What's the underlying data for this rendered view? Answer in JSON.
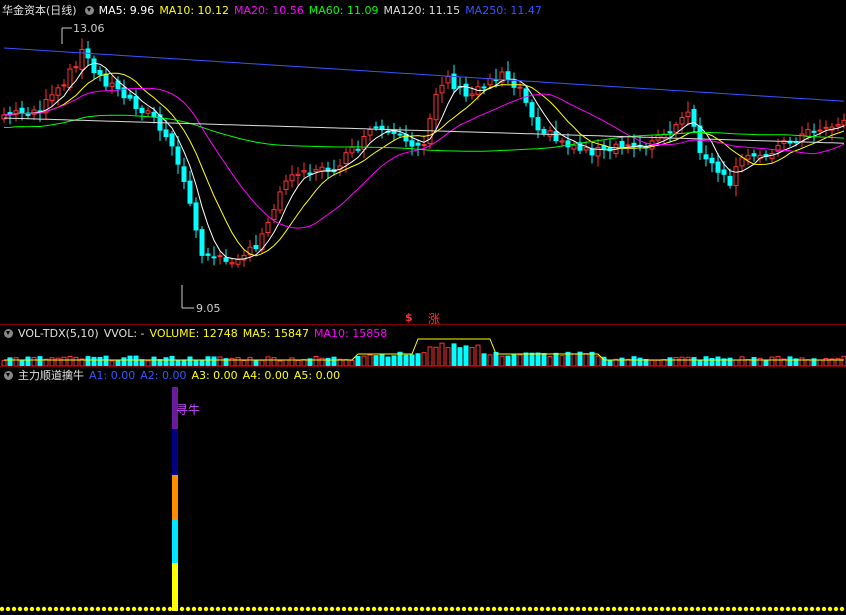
{
  "main_panel": {
    "title": "华金资本(日线)",
    "ma": [
      {
        "label": "MA5: 9.96",
        "color": "#ffffff"
      },
      {
        "label": "MA10: 10.12",
        "color": "#ffff00"
      },
      {
        "label": "MA20: 10.56",
        "color": "#ff00ff"
      },
      {
        "label": "MA60: 11.09",
        "color": "#00ff00"
      },
      {
        "label": "MA120: 11.15",
        "color": "#dddddd"
      },
      {
        "label": "MA250: 11.47",
        "color": "#3355ff"
      }
    ],
    "high_label": "13.06",
    "low_label": "9.05",
    "marker_s": "$",
    "marker_zhang": "涨"
  },
  "volume_panel": {
    "title": "VOL-TDX(5,10)",
    "wol": "VVOL: -",
    "items": [
      {
        "label": "VOLUME: 12748",
        "color": "#ffff00"
      },
      {
        "label": "MA5: 15847",
        "color": "#ffff00"
      },
      {
        "label": "MA10: 15858",
        "color": "#ff00ff"
      }
    ]
  },
  "indicator_panel": {
    "title": "主力顺道擒牛",
    "items": [
      {
        "label": "A1: 0.00",
        "color": "#3355ff"
      },
      {
        "label": "A2: 0.00",
        "color": "#3355ff"
      },
      {
        "label": "A3: 0.00",
        "color": "#ffff00"
      },
      {
        "label": "A4: 0.00",
        "color": "#ffff00"
      },
      {
        "label": "A5: 0.00",
        "color": "#ffff00"
      }
    ],
    "signal_label": "寻牛"
  },
  "colors": {
    "up": "#ff3333",
    "down": "#00ffff",
    "separator": "#800000"
  }
}
